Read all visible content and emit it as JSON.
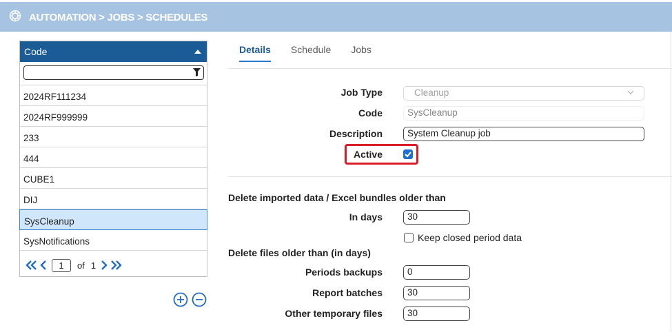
{
  "header": {
    "breadcrumb": "AUTOMATION > JOBS > SCHEDULES"
  },
  "list": {
    "column_header": "Code",
    "filter_value": "",
    "items": [
      "2024RF111234",
      "2024RF999999",
      "233",
      "444",
      "CUBE1",
      "DIJ",
      "SysCleanup",
      "SysNotifications"
    ],
    "selected_item": "SysCleanup",
    "pager": {
      "page": "1",
      "of_label": "of",
      "total_pages": "1"
    }
  },
  "tabs": [
    {
      "label": "Details",
      "active": true
    },
    {
      "label": "Schedule",
      "active": false
    },
    {
      "label": "Jobs",
      "active": false
    }
  ],
  "form": {
    "job_type": {
      "label": "Job Type",
      "value": "Cleanup"
    },
    "code": {
      "label": "Code",
      "value": "SysCleanup"
    },
    "description": {
      "label": "Description",
      "value": "System Cleanup job"
    },
    "active": {
      "label": "Active",
      "checked": true
    }
  },
  "imported": {
    "title": "Delete imported data / Excel bundles older than",
    "in_days": {
      "label": "In days",
      "value": "30"
    },
    "keep_closed": {
      "label": "Keep closed period data",
      "checked": false
    }
  },
  "files": {
    "title": "Delete files older than (in days)",
    "periods_backups": {
      "label": "Periods backups",
      "value": "0"
    },
    "report_batches": {
      "label": "Report batches",
      "value": "30"
    },
    "other_temp": {
      "label": "Other temporary files",
      "value": "30"
    }
  },
  "colors": {
    "title_bar": "#a6c4e2",
    "list_header": "#1b5b96",
    "accent": "#1f6fd1",
    "highlight_border": "#d91e2a",
    "selected_row": "#cfe6fb"
  },
  "icons": [
    "app-logo-icon",
    "sort-ascending-icon",
    "filter-icon",
    "first-page-icon",
    "prev-page-icon",
    "next-page-icon",
    "last-page-icon",
    "add-circle-icon",
    "remove-circle-icon",
    "chevron-down-icon",
    "checkbox-checked-icon"
  ]
}
